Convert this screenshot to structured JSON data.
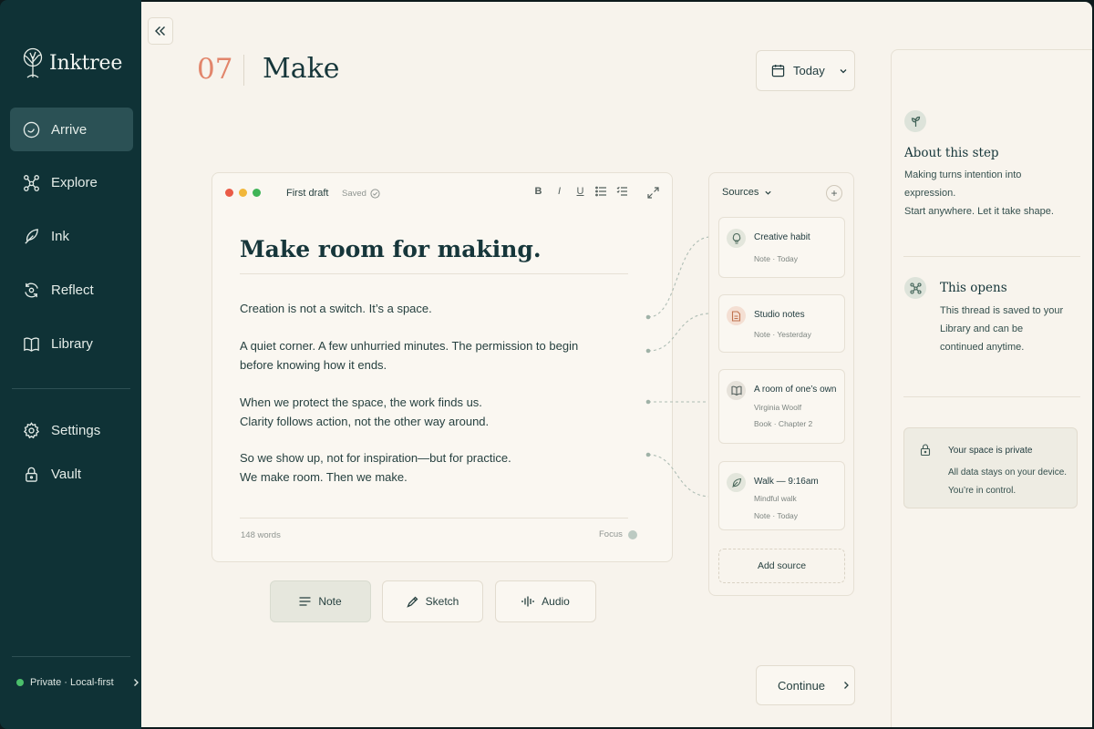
{
  "sidebar": {
    "brand": "Inktree",
    "nav": [
      {
        "label": "Arrive",
        "icon": "arrive-icon",
        "active": true
      },
      {
        "label": "Explore",
        "icon": "explore-icon"
      },
      {
        "label": "Ink",
        "icon": "feather-icon"
      },
      {
        "label": "Reflect",
        "icon": "reflect-icon"
      },
      {
        "label": "Library",
        "icon": "book-icon"
      }
    ],
    "secondary": [
      {
        "label": "Settings",
        "icon": "gear-icon"
      },
      {
        "label": "Vault",
        "icon": "lock-icon"
      }
    ],
    "status": "Private · Local-first"
  },
  "header": {
    "step_number": "07",
    "step_title": "Make",
    "date_filter": "Today"
  },
  "editor": {
    "doc_name": "First draft",
    "save_state": "Saved",
    "tools": [
      "B",
      "I",
      "U"
    ],
    "title": "Make room for making.",
    "paragraphs": [
      [
        "Creation is not a switch. It’s a space."
      ],
      [
        "A quiet corner. A few unhurried minutes. The permission to begin",
        "before knowing how it ends."
      ],
      [
        "When we protect the space, the work finds us.",
        "Clarity follows action, not the other way around."
      ],
      [
        "So we show up, not for inspiration—but for practice.",
        "We make room. Then we make."
      ]
    ],
    "word_count": "148 words",
    "focus_label": "Focus"
  },
  "modes": [
    {
      "label": "Note",
      "icon": "lines-icon",
      "active": true
    },
    {
      "label": "Sketch",
      "icon": "pen-icon"
    },
    {
      "label": "Audio",
      "icon": "waveform-icon"
    }
  ],
  "sources": {
    "header": "Sources",
    "items": [
      {
        "title": "Creative habit",
        "lines": [
          "Note · Today"
        ],
        "icon": "lightbulb-icon",
        "tint": "#e3e6dc"
      },
      {
        "title": "Studio notes",
        "lines": [
          "Note · Yesterday"
        ],
        "icon": "document-icon",
        "tint": "#f4dfd3"
      },
      {
        "title": "A room of one’s own",
        "lines": [
          "Virginia Woolf",
          "Book · Chapter 2"
        ],
        "icon": "book-icon",
        "tint": "#e6e2da"
      },
      {
        "title": "Walk — 9:16am",
        "lines": [
          "Mindful walk",
          "Note · Today"
        ],
        "icon": "leaf-icon",
        "tint": "#e3e6dc"
      }
    ],
    "add_label": "Add source"
  },
  "continue_label": "Continue",
  "right_panel": {
    "about_title": "About this step",
    "about_lines": [
      "Making turns intention into",
      "expression.",
      "Start anywhere. Let it take shape."
    ],
    "opens_title": "This opens",
    "opens_lines": [
      "This thread is saved to your",
      "Library and can be",
      "continued anytime."
    ],
    "private_title": "Your space is private",
    "private_lines": [
      "All data stays on your device.",
      "You’re in control."
    ]
  },
  "colors": {
    "sidebar_bg": "#0f3236",
    "accent_step": "#e2856b",
    "canvas_bg": "#f7f3ec",
    "status_green": "#4bbf6b"
  }
}
